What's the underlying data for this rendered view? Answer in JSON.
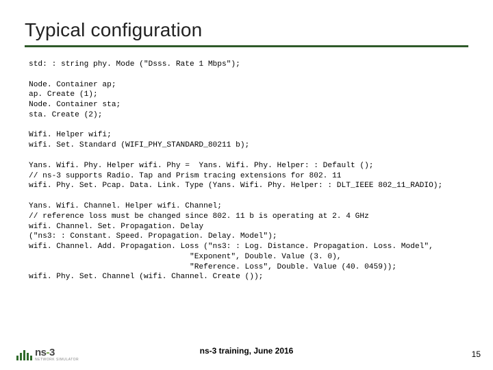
{
  "title": "Typical configuration",
  "code": "std: : string phy. Mode (\"Dsss. Rate 1 Mbps\");\n\nNode. Container ap;\nap. Create (1);\nNode. Container sta;\nsta. Create (2);\n\nWifi. Helper wifi;\nwifi. Set. Standard (WIFI_PHY_STANDARD_80211 b);\n\nYans. Wifi. Phy. Helper wifi. Phy =  Yans. Wifi. Phy. Helper: : Default ();\n// ns-3 supports Radio. Tap and Prism tracing extensions for 802. 11\nwifi. Phy. Set. Pcap. Data. Link. Type (Yans. Wifi. Phy. Helper: : DLT_IEEE 802_11_RADIO);\n\nYans. Wifi. Channel. Helper wifi. Channel;\n// reference loss must be changed since 802. 11 b is operating at 2. 4 GHz\nwifi. Channel. Set. Propagation. Delay\n(\"ns3: : Constant. Speed. Propagation. Delay. Model\");\nwifi. Channel. Add. Propagation. Loss (\"ns3: : Log. Distance. Propagation. Loss. Model\",\n                                   \"Exponent\", Double. Value (3. 0),\n                                   \"Reference. Loss\", Double. Value (40. 0459));\nwifi. Phy. Set. Channel (wifi. Channel. Create ());",
  "footer": "ns-3 training, June 2016",
  "logo": {
    "main_a": "ns",
    "main_dash": "-",
    "main_b": "3",
    "sub": "NETWORK SIMULATOR"
  },
  "page": "15"
}
